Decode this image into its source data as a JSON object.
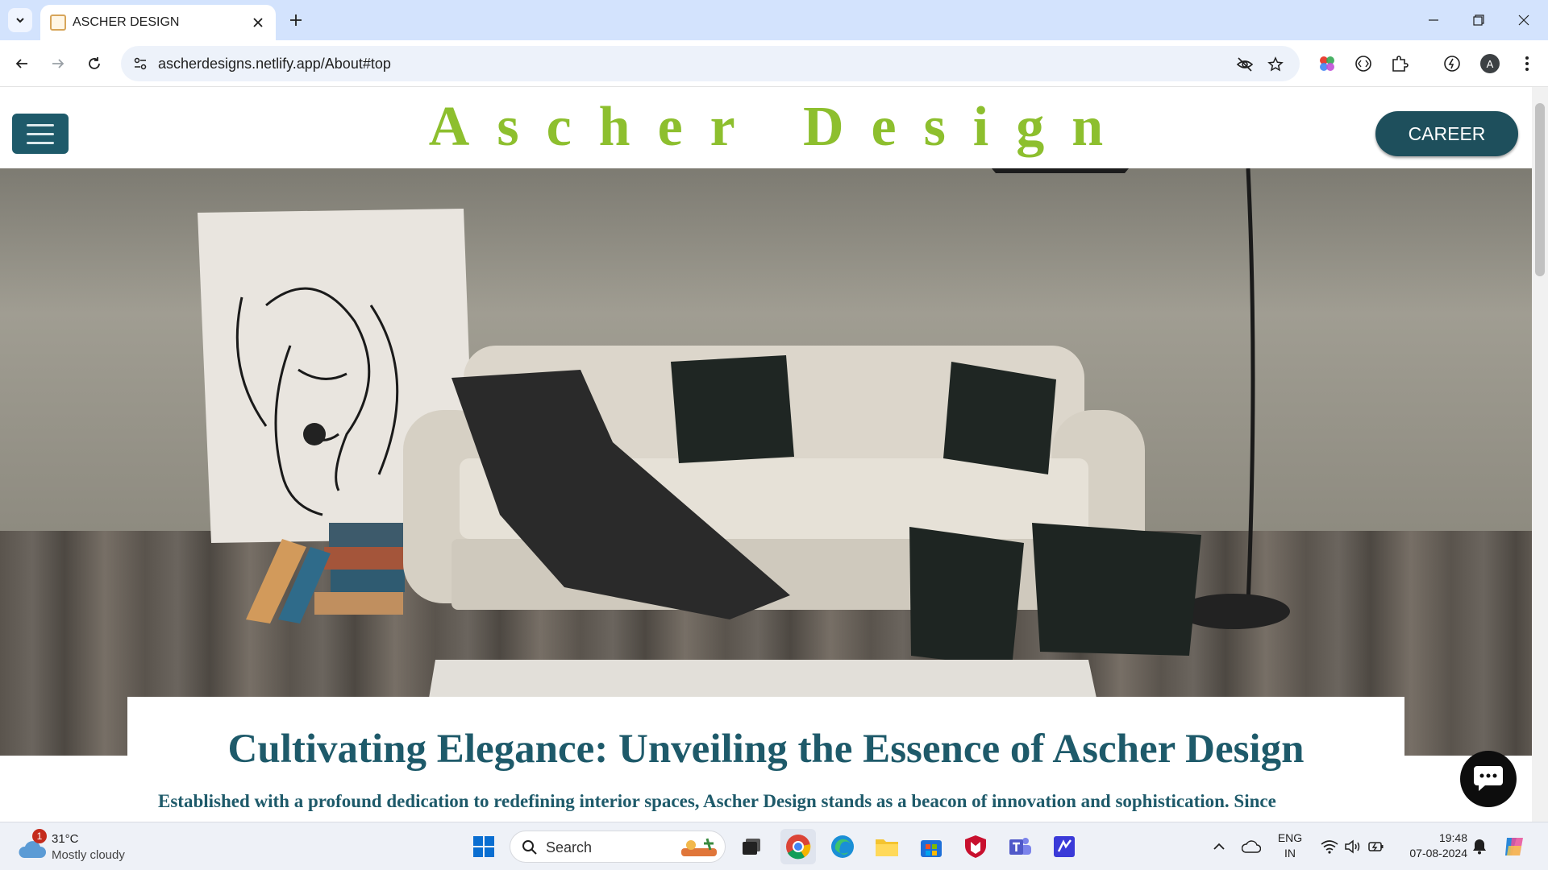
{
  "browser": {
    "tab_title": "ASCHER DESIGN",
    "url": "ascherdesigns.netlify.app/About#top"
  },
  "site": {
    "brand_title": "Ascher Design",
    "career_label": "CAREER",
    "about_heading": "Cultivating Elegance: Unveiling the Essence of Ascher Design",
    "about_intro": "Established with a profound dedication to redefining interior spaces, Ascher Design stands as a beacon of innovation and sophistication. Since"
  },
  "taskbar": {
    "weather_badge": "1",
    "weather_temp": "31°C",
    "weather_desc": "Mostly cloudy",
    "search_label": "Search",
    "lang_line1": "ENG",
    "lang_line2": "IN",
    "time": "19:48",
    "date": "07-08-2024"
  },
  "colors": {
    "brand_green": "#8dbf2e",
    "brand_teal": "#1e5a6a"
  }
}
